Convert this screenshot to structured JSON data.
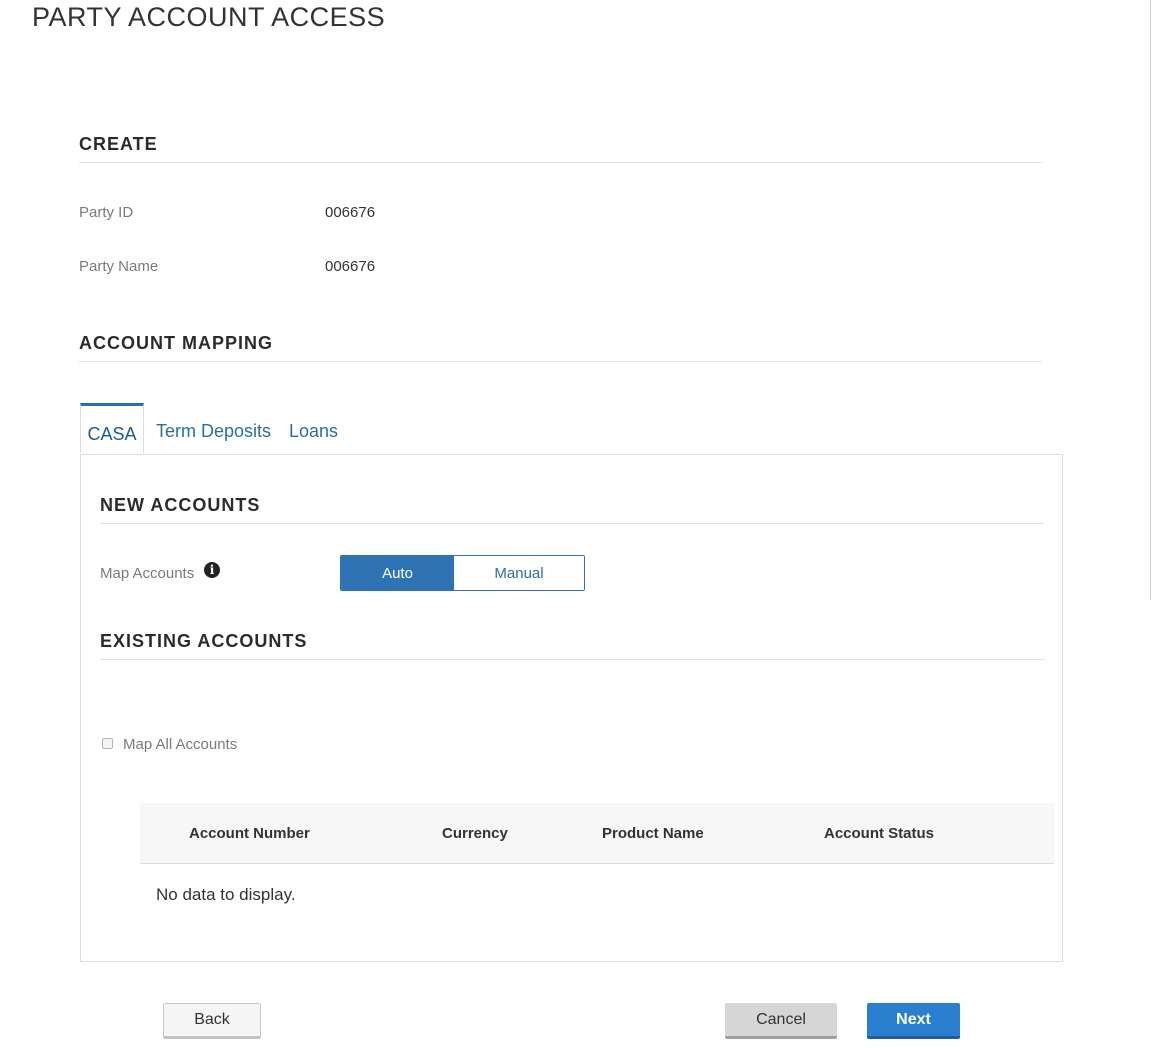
{
  "page": {
    "title": "PARTY ACCOUNT ACCESS"
  },
  "create_section": {
    "heading": "CREATE",
    "party_id_label": "Party ID",
    "party_id_value": "006676",
    "party_name_label": "Party Name",
    "party_name_value": "006676"
  },
  "account_mapping": {
    "heading": "ACCOUNT MAPPING",
    "tabs": [
      {
        "label": "CASA",
        "active": true
      },
      {
        "label": "Term Deposits",
        "active": false
      },
      {
        "label": "Loans",
        "active": false
      }
    ]
  },
  "new_accounts": {
    "heading": "NEW ACCOUNTS",
    "map_accounts_label": "Map Accounts",
    "info_icon": "info-circle-icon",
    "toggle": {
      "options": [
        "Auto",
        "Manual"
      ],
      "selected": "Auto"
    }
  },
  "existing_accounts": {
    "heading": "EXISTING ACCOUNTS",
    "map_all_label": "Map All Accounts",
    "map_all_checked": false,
    "table": {
      "columns": [
        "Account Number",
        "Currency",
        "Product Name",
        "Account Status"
      ],
      "rows": [],
      "empty_message": "No data to display."
    }
  },
  "actions": {
    "back_label": "Back",
    "cancel_label": "Cancel",
    "next_label": "Next"
  },
  "colors": {
    "accent": "#2e74b5",
    "primary_button": "#2a7fd0",
    "tab_link": "#2c6ea3"
  }
}
